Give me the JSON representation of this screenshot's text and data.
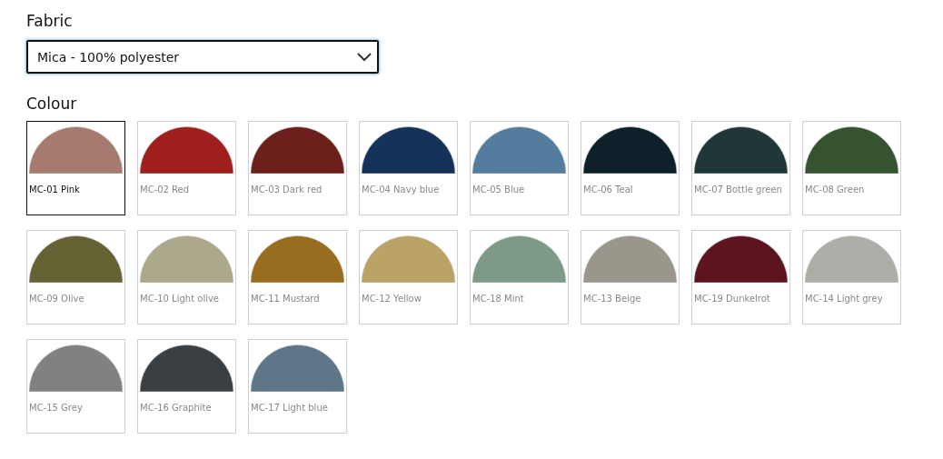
{
  "fabric": {
    "label": "Fabric",
    "select": {
      "value": "Mica - 100% polyester"
    }
  },
  "colour": {
    "label": "Colour",
    "swatches": [
      {
        "name": "MC-01 Pink",
        "color": "#a57a6f",
        "selected": true
      },
      {
        "name": "MC-02 Red",
        "color": "#9e1f1b",
        "selected": false
      },
      {
        "name": "MC-03 Dark red",
        "color": "#6c1f1b",
        "selected": false
      },
      {
        "name": "MC-04 Navy blue",
        "color": "#15325a",
        "selected": false
      },
      {
        "name": "MC-05 Blue",
        "color": "#537c9e",
        "selected": false
      },
      {
        "name": "MC-06 Teal",
        "color": "#0e212a",
        "selected": false
      },
      {
        "name": "MC-07 Bottle green",
        "color": "#1f3736",
        "selected": false
      },
      {
        "name": "MC-08 Green",
        "color": "#34532e",
        "selected": false
      },
      {
        "name": "MC-09 Olive",
        "color": "#656233",
        "selected": false
      },
      {
        "name": "MC-10 Light olive",
        "color": "#aba88b",
        "selected": false
      },
      {
        "name": "MC-11 Mustard",
        "color": "#996d20",
        "selected": false
      },
      {
        "name": "MC-12 Yellow",
        "color": "#bba266",
        "selected": false
      },
      {
        "name": "MC-18 Mint",
        "color": "#7c9a87",
        "selected": false
      },
      {
        "name": "MC-13 Beige",
        "color": "#9b968c",
        "selected": false
      },
      {
        "name": "MC-19 Dunkelrot",
        "color": "#5e141f",
        "selected": false
      },
      {
        "name": "MC-14 Light grey",
        "color": "#adaea7",
        "selected": false
      },
      {
        "name": "MC-15 Grey",
        "color": "#818181",
        "selected": false
      },
      {
        "name": "MC-16 Graphite",
        "color": "#3a3f43",
        "selected": false
      },
      {
        "name": "MC-17 Light blue",
        "color": "#5f7688",
        "selected": false
      }
    ]
  }
}
